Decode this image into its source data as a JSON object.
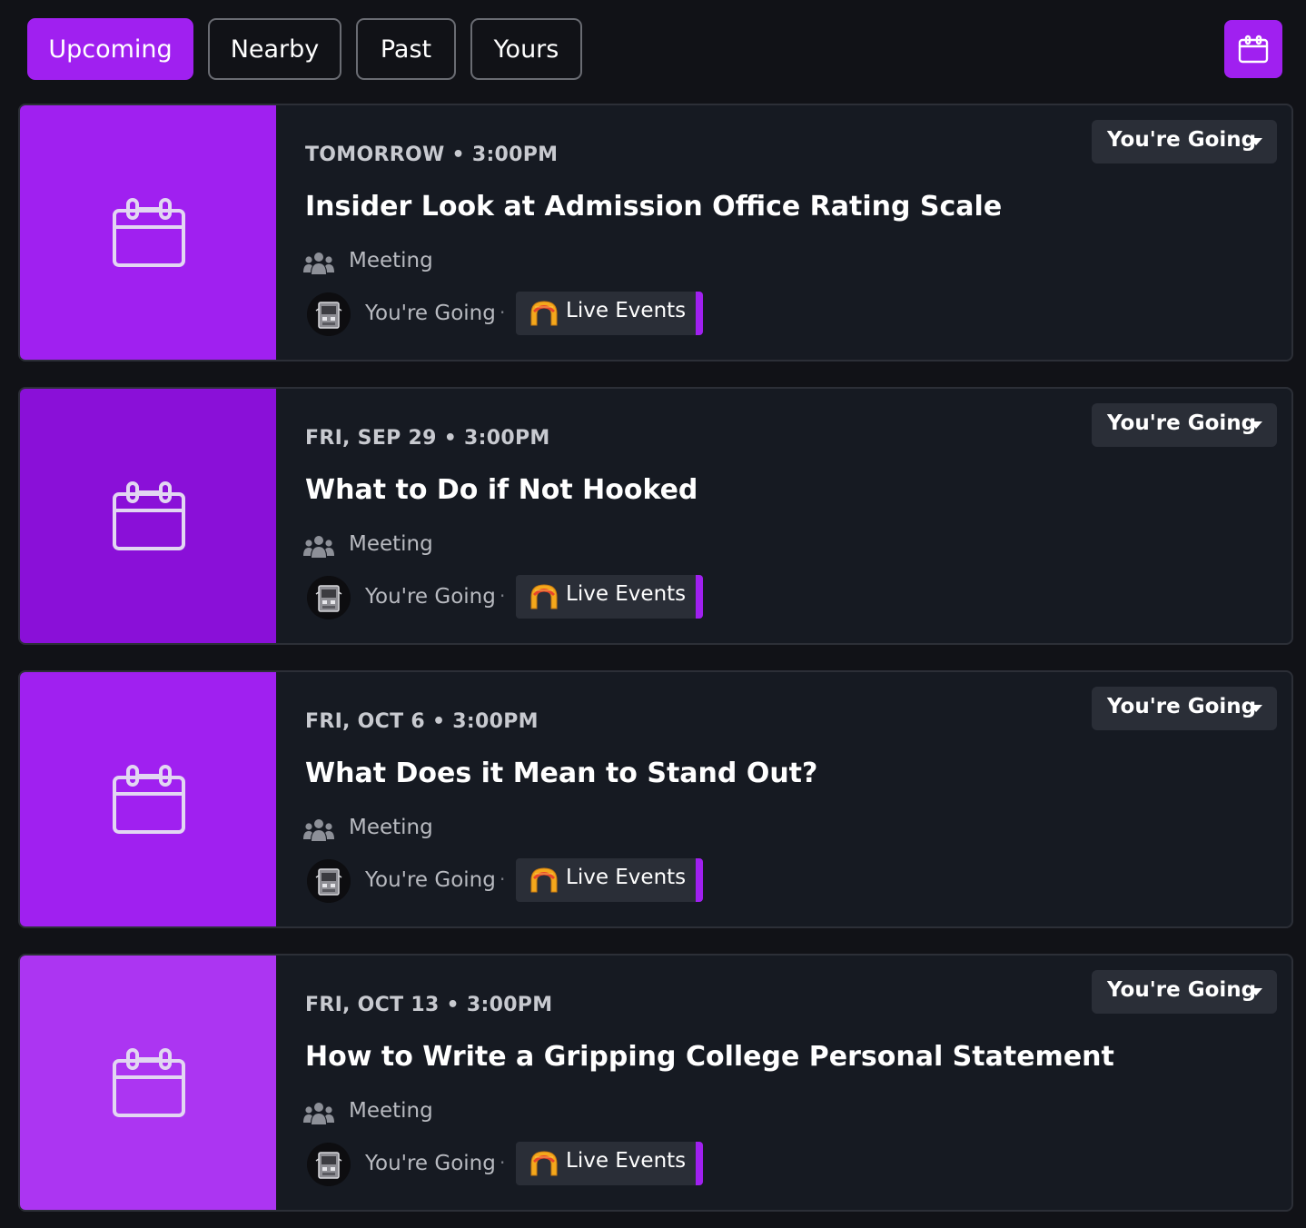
{
  "tabs": [
    {
      "label": "Upcoming",
      "active": true
    },
    {
      "label": "Nearby",
      "active": false
    },
    {
      "label": "Past",
      "active": false
    },
    {
      "label": "Yours",
      "active": false
    }
  ],
  "calendar_button_icon": "calendar-icon",
  "colors": {
    "accent": "#a020f0",
    "card_bg": "#161a22",
    "page_bg": "#111217",
    "chip_bg": "#2a2e37"
  },
  "events": [
    {
      "datetime": "TOMORROW • 3:00PM",
      "title": "Insider Look at Admission Office Rating Scale",
      "type": "Meeting",
      "status": "You're Going",
      "separator": "·",
      "channel": "Live Events",
      "rsvp_label": "You're Going",
      "thumb_color": "#a020f0"
    },
    {
      "datetime": "FRI, SEP 29 • 3:00PM",
      "title": "What to Do if Not Hooked",
      "type": "Meeting",
      "status": "You're Going",
      "separator": "·",
      "channel": "Live Events",
      "rsvp_label": "You're Going",
      "thumb_color": "#8a10d8"
    },
    {
      "datetime": "FRI, OCT 6 • 3:00PM",
      "title": "What Does it Mean to Stand Out?",
      "type": "Meeting",
      "status": "You're Going",
      "separator": "·",
      "channel": "Live Events",
      "rsvp_label": "You're Going",
      "thumb_color": "#a020f0"
    },
    {
      "datetime": "FRI, OCT 13 • 3:00PM",
      "title": "How to Write a Gripping College Personal Statement",
      "type": "Meeting",
      "status": "You're Going",
      "separator": "·",
      "channel": "Live Events",
      "rsvp_label": "You're Going",
      "thumb_color": "#ac35f2"
    }
  ]
}
